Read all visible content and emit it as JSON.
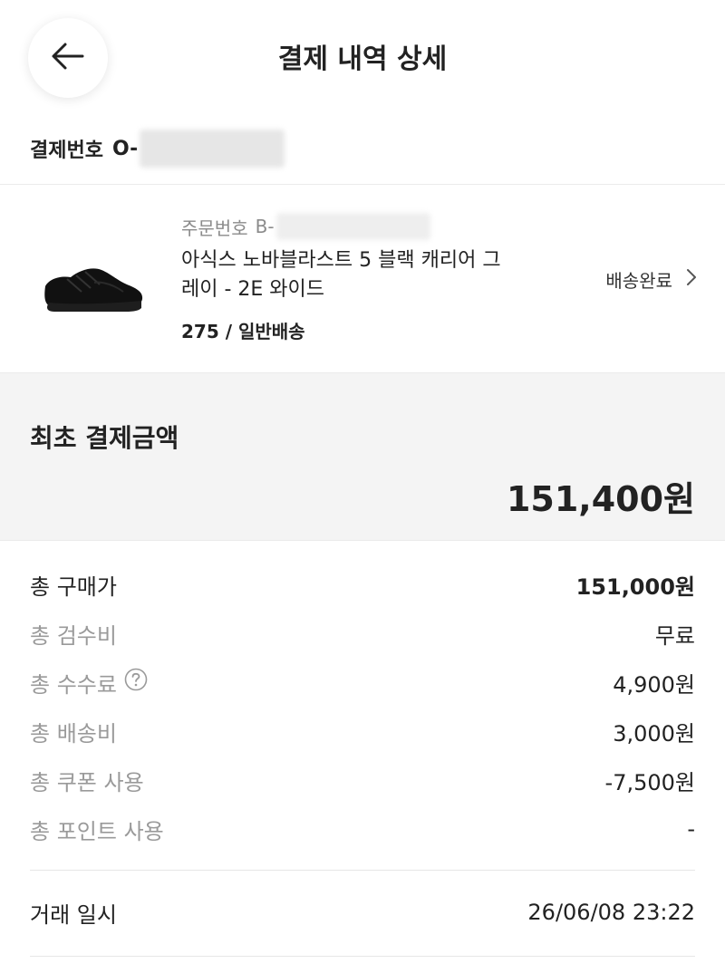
{
  "header": {
    "title": "결제 내역 상세",
    "back_icon": "arrow-left-icon"
  },
  "payment": {
    "label": "결제번호",
    "number_prefix": "O-"
  },
  "order": {
    "order_label": "주문번호",
    "order_prefix": "B-",
    "product_name_line1": "아식스 노바블라스트 5 블랙 캐리어 그",
    "product_name_line2": "레이 - 2E 와이드",
    "option": "275 / 일반배송",
    "status": "배송완료",
    "status_icon": "chevron-right-icon",
    "image_icon": "black-running-shoe"
  },
  "initial_payment": {
    "label": "최초 결제금액",
    "amount": "151,400원"
  },
  "breakdown": [
    {
      "label": "총 구매가",
      "value": "151,000원"
    },
    {
      "label": "총 검수비",
      "value": "무료"
    },
    {
      "label": "총 수수료",
      "value": "4,900원"
    },
    {
      "label": "총 배송비",
      "value": "3,000원"
    },
    {
      "label": "총 쿠폰 사용",
      "value": "-7,500원"
    },
    {
      "label": "총 포인트 사용",
      "value": "-"
    }
  ],
  "transaction": {
    "label": "거래 일시",
    "value": "26/06/08 23:22"
  },
  "colors": {
    "text": "#222222",
    "muted": "#9a9a9a",
    "panel": "#f4f4f4",
    "divider": "#ebebeb"
  }
}
